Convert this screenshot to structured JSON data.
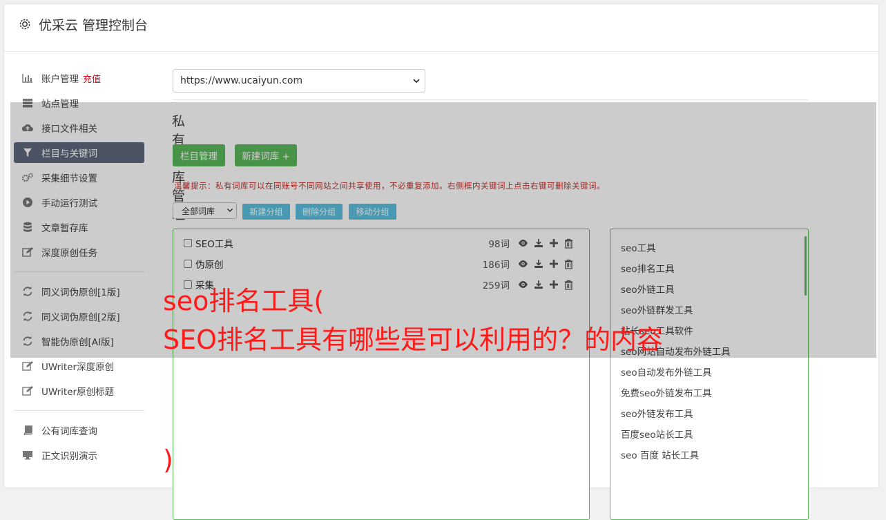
{
  "header": {
    "title": "优采云 管理控制台"
  },
  "sidebar": {
    "items": [
      {
        "label": "账户管理",
        "badge": "充值",
        "icon": "bar-chart-icon"
      },
      {
        "label": "站点管理",
        "icon": "server-icon"
      },
      {
        "label": "接口文件相关",
        "icon": "cloud-upload-icon"
      },
      {
        "label": "栏目与关键词",
        "icon": "filter-icon",
        "active": true
      },
      {
        "label": "采集细节设置",
        "icon": "gears-icon"
      },
      {
        "label": "手动运行测试",
        "icon": "play-circle-icon"
      },
      {
        "label": "文章暂存库",
        "icon": "database-icon"
      },
      {
        "label": "深度原创任务",
        "icon": "edit-icon"
      },
      {
        "label": "同义词伪原创[1版]",
        "icon": "refresh-icon"
      },
      {
        "label": "同义词伪原创[2版]",
        "icon": "refresh-icon"
      },
      {
        "label": "智能伪原创[AI版]",
        "icon": "refresh-icon"
      },
      {
        "label": "UWriter深度原创",
        "icon": "edit-icon"
      },
      {
        "label": "UWriter原创标题",
        "icon": "edit-icon"
      },
      {
        "label": "公有词库查询",
        "icon": "book-icon"
      },
      {
        "label": "正文识别演示",
        "icon": "monitor-icon"
      }
    ]
  },
  "main": {
    "site_select": {
      "value": "https://www.ucaiyun.com"
    },
    "page_title": "私有词库管理",
    "buttons": {
      "column_manage": "栏目管理",
      "new_library": "新建词库 +"
    },
    "tip": "温馨提示：私有词库可以在同账号不同网站之间共享使用，不必重复添加。右侧框内关键词上点击右键可删除关键词。",
    "library_select": {
      "value": "全部词库"
    },
    "group_buttons": {
      "new_group": "新建分组",
      "delete_group": "删除分组",
      "move_group": "移动分组"
    },
    "groups": [
      {
        "name": "SEO工具",
        "count": "98词"
      },
      {
        "name": "伪原创",
        "count": "186词"
      },
      {
        "name": "采集",
        "count": "259词"
      }
    ],
    "keywords": [
      "seo工具",
      "seo排名工具",
      "seo外链工具",
      "seo外链群发工具",
      "站长seo工具软件",
      "seo网站自动发布外链工具",
      "seo自动发布外链工具",
      "免费seo外链发布工具",
      "seo外链发布工具",
      "百度seo站长工具",
      "seo 百度 站长工具"
    ]
  },
  "overlay": {
    "line1": "seo排名工具(",
    "line2": "SEO排名工具有哪些是可以利用的？的内容",
    "line3": ")"
  },
  "colors": {
    "green": "#5cb85c",
    "blue": "#5bc0de",
    "active_nav": "#5f6a7d",
    "headline": "#ff1a1a",
    "tip": "#c9302c"
  }
}
